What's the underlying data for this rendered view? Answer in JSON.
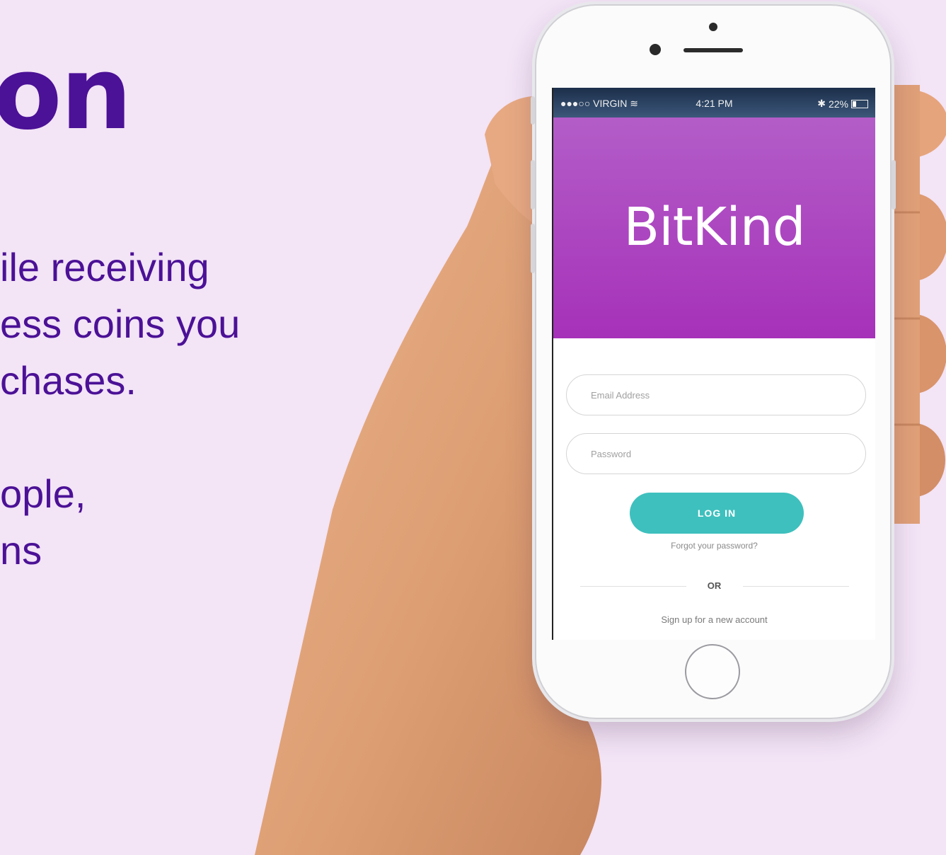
{
  "marketing": {
    "headline": "on",
    "lines": [
      "ile receiving",
      "ess coins you",
      "chases.",
      "",
      "ople,",
      "ns"
    ]
  },
  "phone": {
    "status_bar": {
      "carrier": "●●●○○ VIRGIN",
      "time": "4:21 PM",
      "battery": "22%"
    },
    "app": {
      "brand": "BitKind",
      "email_placeholder": "Email Address",
      "password_placeholder": "Password",
      "login_label": "LOG IN",
      "forgot_link": "Forgot your password?",
      "or_label": "OR",
      "signup_link": "Sign up for a new account"
    }
  },
  "colors": {
    "background": "#f3e4f6",
    "headline": "#4b1196",
    "hero_top": "#b35dc8",
    "hero_bottom": "#a631b9",
    "login_button": "#3ec0be"
  },
  "icons": [
    "wifi-icon",
    "bluetooth-icon",
    "battery-icon",
    "home-button"
  ]
}
